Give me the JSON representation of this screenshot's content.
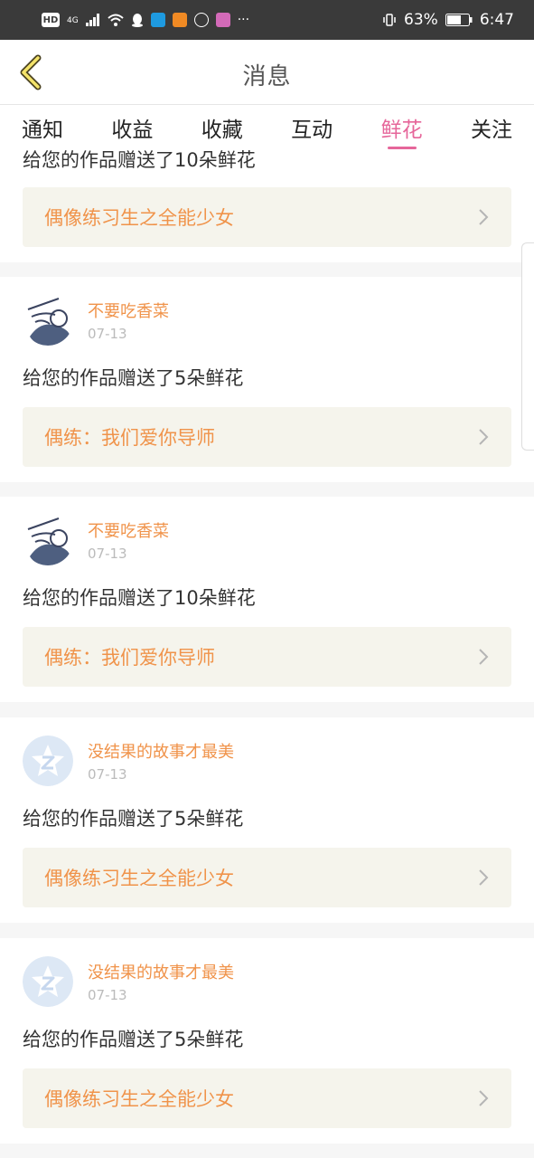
{
  "status_bar": {
    "left_labels": [
      "HD",
      "4G"
    ],
    "icons": [
      "signal-icon",
      "wifi-icon",
      "qq-icon",
      "app-icon-blue",
      "app-icon-orange",
      "app-icon-hand",
      "app-icon-colorful"
    ],
    "more": "···",
    "battery_percent": "63%",
    "time": "6:47"
  },
  "header": {
    "title": "消息"
  },
  "tabs": [
    {
      "label": "通知",
      "active": false
    },
    {
      "label": "收益",
      "active": false
    },
    {
      "label": "收藏",
      "active": false
    },
    {
      "label": "互动",
      "active": false
    },
    {
      "label": "鲜花",
      "active": true
    },
    {
      "label": "关注",
      "active": false
    }
  ],
  "partial_card": {
    "message": "给您的作品赠送了10朵鲜花",
    "work_title": "偶像练习生之全能少女"
  },
  "cards": [
    {
      "username": "不要吃香菜",
      "date": "07-13",
      "message": "给您的作品赠送了5朵鲜花",
      "work_title": "偶练：我们爱你导师",
      "avatar": "sketch-avatar"
    },
    {
      "username": "不要吃香菜",
      "date": "07-13",
      "message": "给您的作品赠送了10朵鲜花",
      "work_title": "偶练：我们爱你导师",
      "avatar": "sketch-avatar"
    },
    {
      "username": "没结果的故事才最美",
      "date": "07-13",
      "message": "给您的作品赠送了5朵鲜花",
      "work_title": "偶像练习生之全能少女",
      "avatar": "default-avatar"
    },
    {
      "username": "没结果的故事才最美",
      "date": "07-13",
      "message": "给您的作品赠送了5朵鲜花",
      "work_title": "偶像练习生之全能少女",
      "avatar": "default-avatar"
    }
  ],
  "colors": {
    "accent_pink": "#e6669a",
    "username_orange": "#f0934a",
    "status_bar": "#3a3a3a",
    "link_bg": "#f5f4ec"
  }
}
